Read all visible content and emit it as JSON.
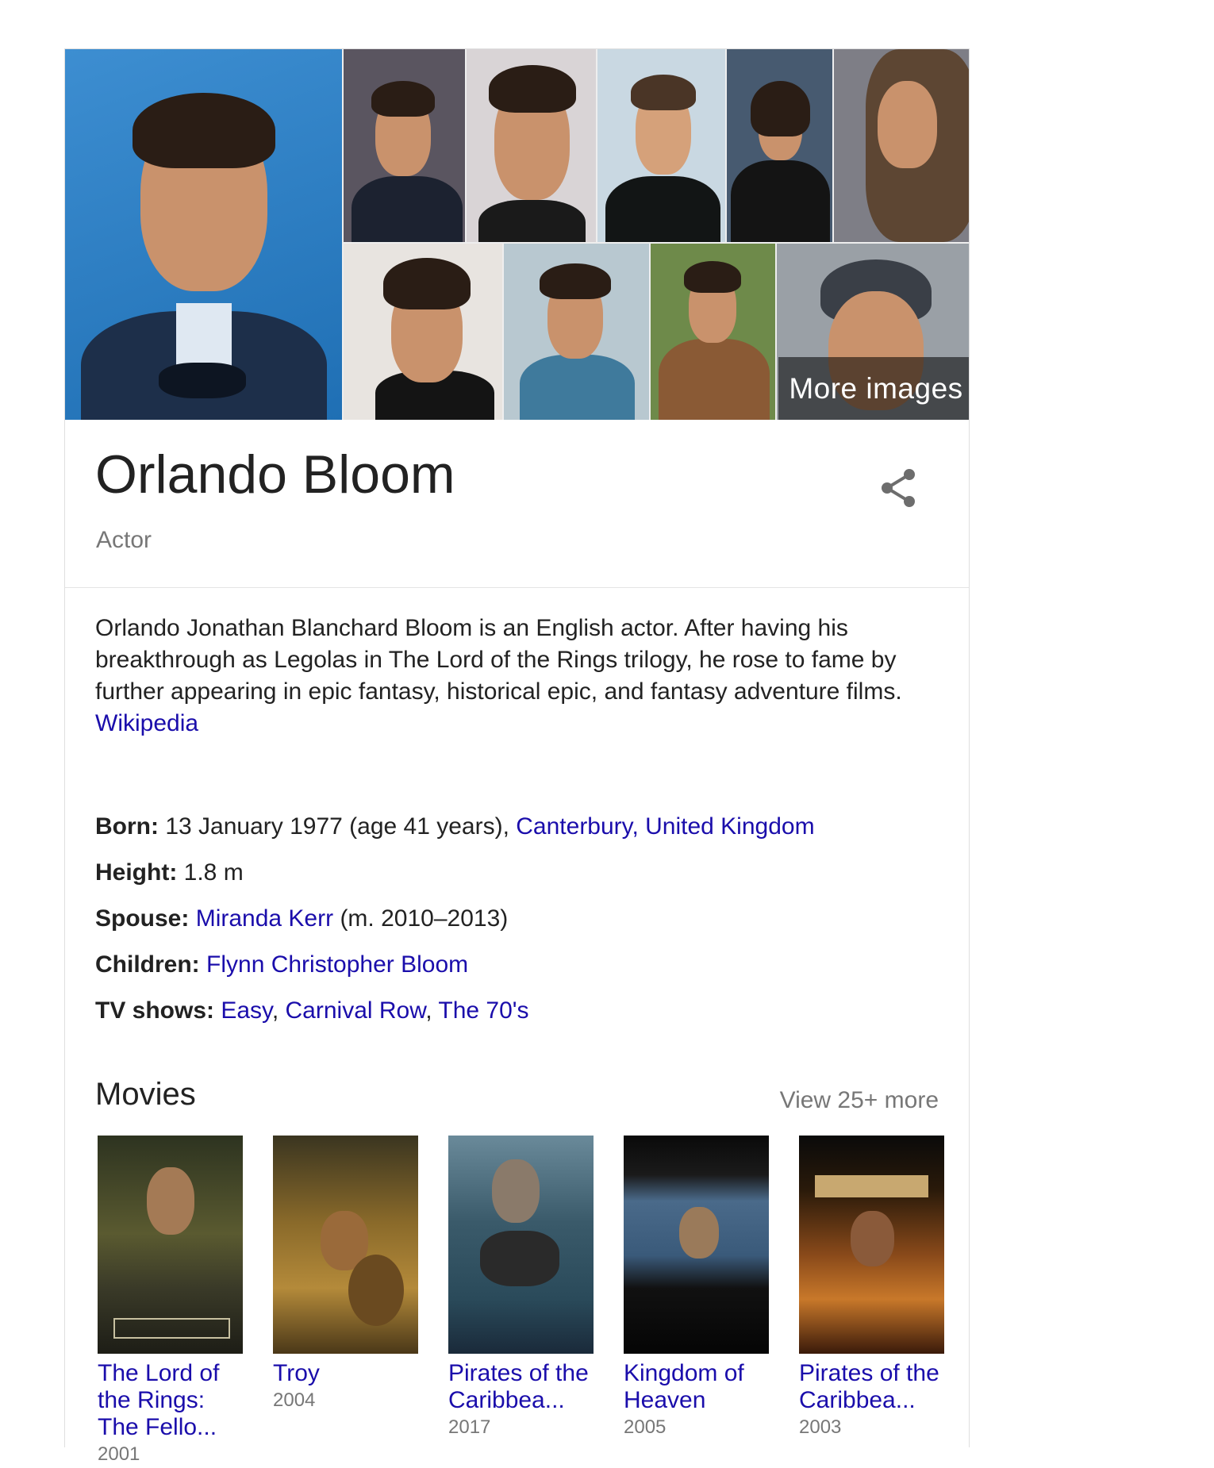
{
  "mosaic": {
    "more_images_label": "More images"
  },
  "entity": {
    "name": "Orlando Bloom",
    "type": "Actor"
  },
  "description": {
    "text": "Orlando Jonathan Blanchard Bloom is an English actor. After having his breakthrough as Legolas in The Lord of the Rings trilogy, he rose to fame by further appearing in epic fantasy, historical epic, and fantasy adventure films. ",
    "source_link": "Wikipedia"
  },
  "facts": {
    "born": {
      "label": "Born:",
      "value": " 13 January 1977 (age 41 years), ",
      "link": "Canterbury, United Kingdom"
    },
    "height": {
      "label": "Height:",
      "value": " 1.8 m"
    },
    "spouse": {
      "label": "Spouse:",
      "link": "Miranda Kerr",
      "value": " (m. 2010–2013)"
    },
    "children": {
      "label": "Children:",
      "link": "Flynn Christopher Bloom"
    },
    "tv_shows": {
      "label": "TV shows:",
      "links": [
        "Easy",
        "Carnival Row",
        "The 70's"
      ],
      "separator": ", "
    }
  },
  "movies": {
    "heading": "Movies",
    "view_more": "View 25+ more",
    "items": [
      {
        "title": "The Lord of the Rings: The Fello...",
        "year": "2001"
      },
      {
        "title": "Troy",
        "year": "2004"
      },
      {
        "title": "Pirates of the Caribbea...",
        "year": "2017"
      },
      {
        "title": "Kingdom of Heaven",
        "year": "2005"
      },
      {
        "title": "Pirates of the Caribbea...",
        "year": "2003"
      }
    ]
  },
  "icons": {
    "share": "share-icon"
  },
  "colors": {
    "link": "#1a0dab",
    "muted": "#777777",
    "text": "#222222"
  }
}
